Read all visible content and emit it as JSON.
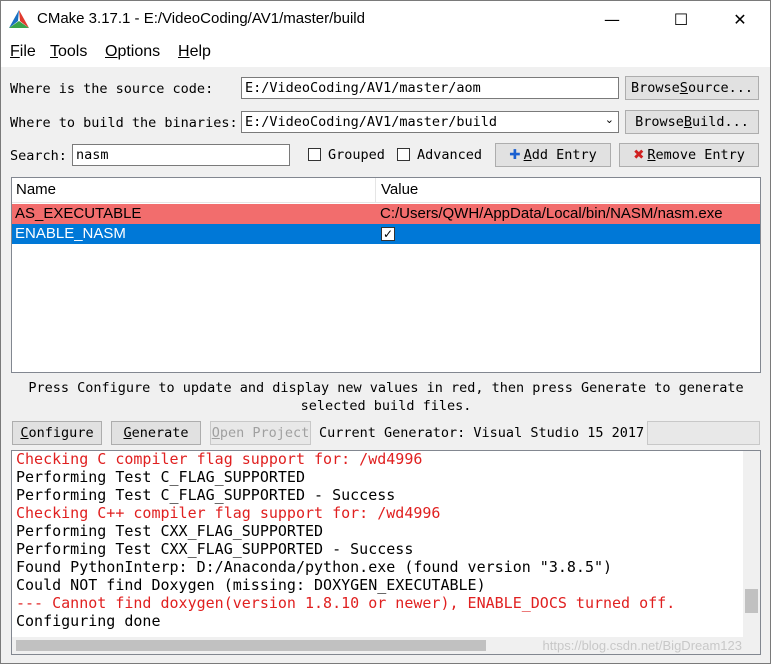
{
  "window": {
    "title": "CMake 3.17.1 - E:/VideoCoding/AV1/master/build",
    "minimize": "—",
    "maximize": "☐",
    "close": "✕"
  },
  "menu": [
    {
      "label": "File",
      "underline": "F"
    },
    {
      "label": "Tools",
      "underline": "T"
    },
    {
      "label": "Options",
      "underline": "O"
    },
    {
      "label": "Help",
      "underline": "H"
    }
  ],
  "source": {
    "label": "Where is the source code:",
    "value": "E:/VideoCoding/AV1/master/aom",
    "browse_label": "Browse Source..."
  },
  "build": {
    "label": "Where to build the binaries:",
    "value": "E:/VideoCoding/AV1/master/build",
    "browse_label": "Browse Build..."
  },
  "search": {
    "label": "Search:",
    "value": "nasm",
    "grouped_label": "Grouped",
    "advanced_label": "Advanced",
    "add_entry_label": "Add Entry",
    "remove_entry_label": "Remove Entry"
  },
  "table": {
    "columns": [
      "Name",
      "Value"
    ],
    "rows": [
      {
        "name": "AS_EXECUTABLE",
        "value": "C:/Users/QWH/AppData/Local/bin/NASM/nasm.exe",
        "state": "new"
      },
      {
        "name": "ENABLE_NASM",
        "value": "",
        "checked": true,
        "state": "selected"
      }
    ]
  },
  "info_text": "Press Configure to update and display new values in red, then press Generate to generate selected build files.",
  "actions": {
    "configure_label": "Configure",
    "generate_label": "Generate",
    "open_project_label": "Open Project",
    "generator_label": "Current Generator: Visual Studio 15 2017"
  },
  "log": [
    {
      "text": "Checking C compiler flag support for: /wd4996",
      "error": true
    },
    {
      "text": "Performing Test C_FLAG_SUPPORTED",
      "error": false
    },
    {
      "text": "Performing Test C_FLAG_SUPPORTED - Success",
      "error": false
    },
    {
      "text": "Checking C++ compiler flag support for: /wd4996",
      "error": true
    },
    {
      "text": "Performing Test CXX_FLAG_SUPPORTED",
      "error": false
    },
    {
      "text": "Performing Test CXX_FLAG_SUPPORTED - Success",
      "error": false
    },
    {
      "text": "Found PythonInterp: D:/Anaconda/python.exe (found version \"3.8.5\")",
      "error": false
    },
    {
      "text": "Could NOT find Doxygen (missing: DOXYGEN_EXECUTABLE)",
      "error": false
    },
    {
      "text": "--- Cannot find doxygen(version 1.8.10 or newer), ENABLE_DOCS turned off.",
      "error": true
    },
    {
      "text": "Configuring done",
      "error": false
    }
  ],
  "watermark": "https://blog.csdn.net/BigDream123",
  "colors": {
    "new_row": "#f26d6d",
    "selected_row": "#0078d7",
    "error_text": "#e02020"
  }
}
